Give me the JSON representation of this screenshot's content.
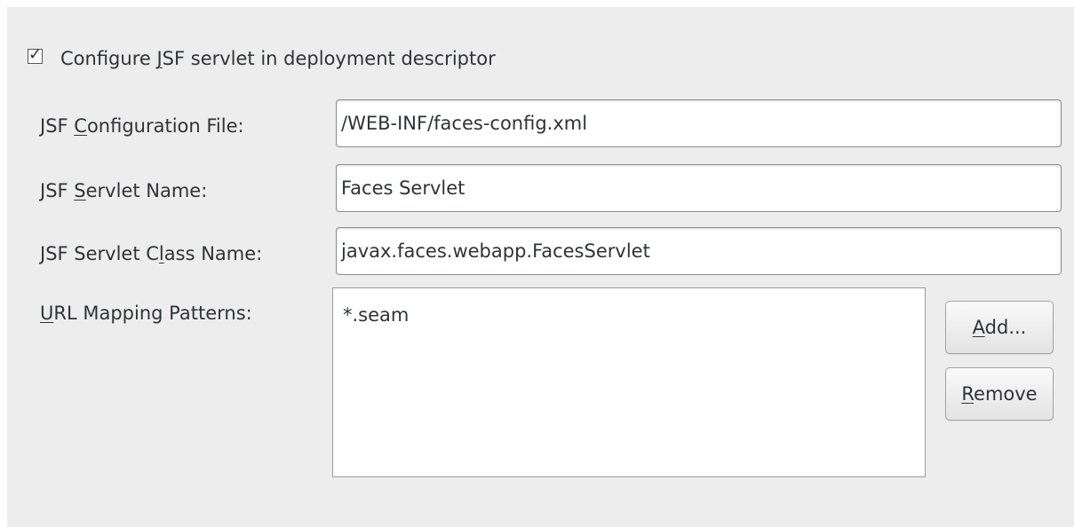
{
  "configure_checkbox": {
    "checked": true,
    "label_pre": "Configure ",
    "label_mnemonic": "J",
    "label_post": "SF servlet in deployment descriptor"
  },
  "config_file": {
    "label_pre": "JSF ",
    "label_mnemonic": "C",
    "label_post": "onfiguration File:",
    "value": "/WEB-INF/faces-config.xml"
  },
  "servlet_name": {
    "label_pre": "JSF ",
    "label_mnemonic": "S",
    "label_post": "ervlet Name:",
    "value": "Faces Servlet"
  },
  "servlet_class": {
    "label_pre": "JSF Servlet C",
    "label_mnemonic": "l",
    "label_post": "ass Name:",
    "value": "javax.faces.webapp.FacesServlet"
  },
  "url_mapping": {
    "label_pre": "",
    "label_mnemonic": "U",
    "label_post": "RL Mapping Patterns:",
    "patterns": [
      "*.seam"
    ]
  },
  "buttons": {
    "add": {
      "pre": "",
      "mnemonic": "A",
      "post": "dd..."
    },
    "remove": {
      "pre": "",
      "mnemonic": "R",
      "post": "emove"
    }
  }
}
